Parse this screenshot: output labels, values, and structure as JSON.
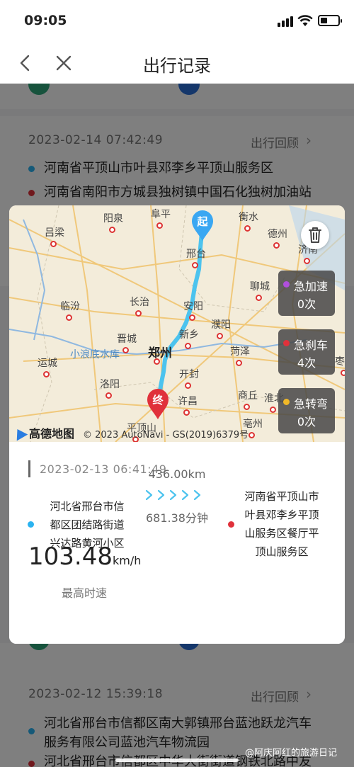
{
  "status_bar": {
    "time": "09:05"
  },
  "nav": {
    "title": "出行记录"
  },
  "records": [
    {
      "datetime": "2023-02-14 07:42:49",
      "replay": "出行回顾",
      "start": "河南省平顶山市叶县邓李乡平顶山服务区",
      "end": "河南省南阳市方城县独树镇中国石化独树加油站"
    },
    {
      "datetime": "2023-02-12 15:39:18",
      "replay": "出行回顾",
      "start_line1": "河北省邢台市信都区南大郭镇邢台蓝池跃龙汽车",
      "start_line2": "服务有限公司蓝池汽车物流园",
      "end": "河北省邢台市信都区中华大街街道钢铁北路中友"
    }
  ],
  "modal": {
    "map": {
      "start_marker": "起",
      "end_marker": "终",
      "cities": [
        "吕梁",
        "阳泉",
        "阜平",
        "衡水",
        "德州",
        "济南",
        "邢台",
        "临汾",
        "长治",
        "安阳",
        "聊城",
        "晋城",
        "濮阳",
        "新乡",
        "郑州",
        "运城",
        "小浪底水库",
        "洛阳",
        "菏泽",
        "开封",
        "商丘",
        "许昌",
        "平顶山",
        "亳州",
        "枣庄",
        "淮北"
      ],
      "attribution": "© 2023 AutoNavi - GS(2019)6379号",
      "logo": "高德地图"
    },
    "events": [
      {
        "name": "急加速",
        "count": "0次",
        "color": "#b04fdc"
      },
      {
        "name": "急刹车",
        "count": "4次",
        "color": "#e0313b"
      },
      {
        "name": "急转弯",
        "count": "0次",
        "color": "#f0b828"
      }
    ],
    "trip": {
      "datetime": "2023-02-13 06:41:49",
      "start_lines": [
        "河北省邢台市信",
        "都区团结路街道",
        "兴达路黄河小区"
      ],
      "end_lines": [
        "河南省平顶山市",
        "叶县邓李乡平顶",
        "山服务区餐厅平",
        "顶山服务区"
      ],
      "distance": "436.00km",
      "duration": "681.38分钟",
      "max_speed": "103.48",
      "speed_unit": "km/h",
      "speed_label": "最高时速"
    },
    "colors": {
      "start_dot": "#2bb3f0",
      "end_dot": "#e0313b",
      "route": "#4cc3ee",
      "end_pin": "#e0313b",
      "start_pin": "#3aa7f2"
    }
  },
  "watermark": "@阿庆阿红的旅游日记"
}
